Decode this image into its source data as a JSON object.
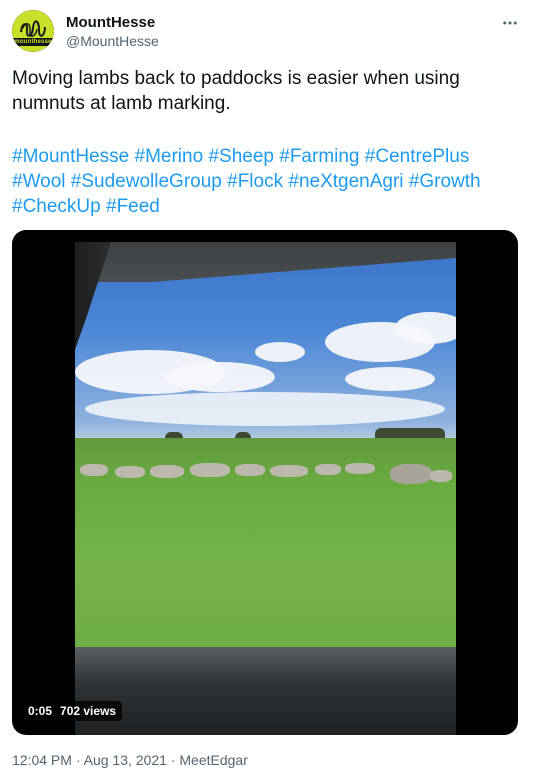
{
  "user": {
    "display_name": "MountHesse",
    "handle": "@MountHesse",
    "avatar_text": "mounthesse"
  },
  "tweet": {
    "text": "Moving lambs back to paddocks is easier when using numnuts at lamb marking.",
    "hashtags": [
      "#MountHesse",
      "#Merino",
      "#Sheep",
      "#Farming",
      "#CentrePlus",
      "#Wool",
      "#SudewolleGroup",
      "#Flock",
      "#neXtgenAgri",
      "#Growth",
      "#CheckUp",
      "#Feed"
    ]
  },
  "media": {
    "time": "0:05",
    "views": "702 views"
  },
  "footer": {
    "time": "12:04 PM",
    "separator1": "·",
    "date": "Aug 13, 2021",
    "separator2": "·",
    "source": "MeetEdgar"
  },
  "icons": {
    "more": "more-horizontal-icon"
  },
  "colors": {
    "link": "#1d9bf0",
    "secondary_text": "#536471",
    "avatar_accent": "#c8e02a"
  }
}
